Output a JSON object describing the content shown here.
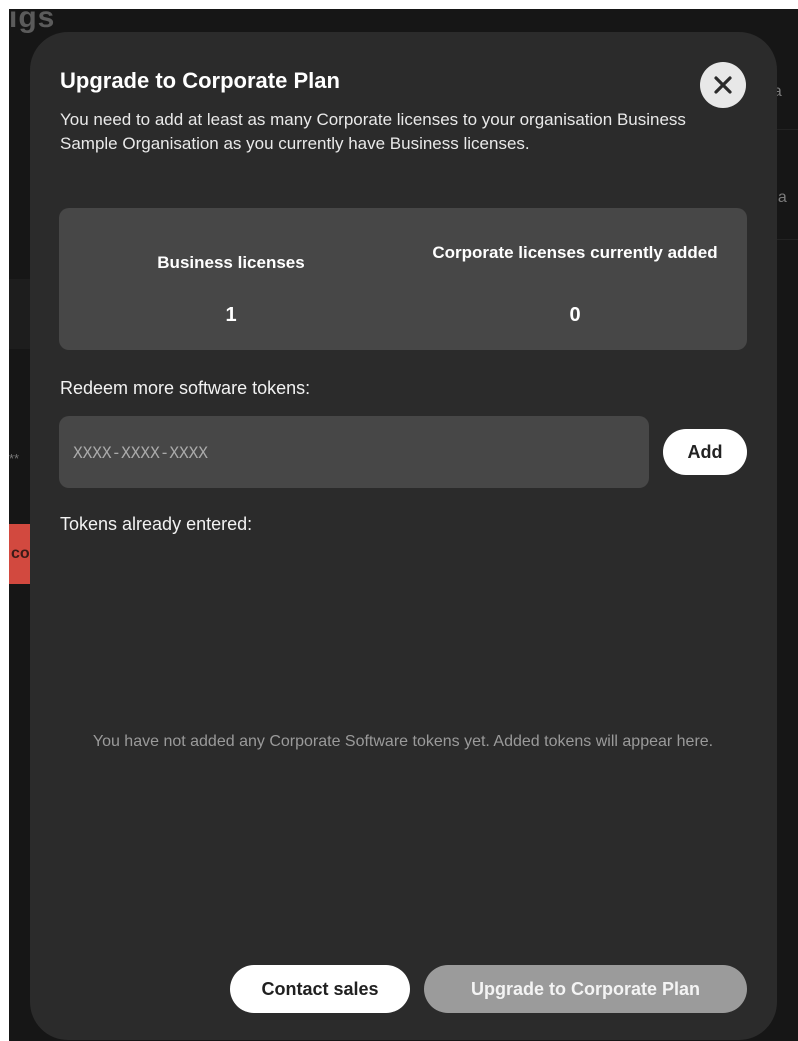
{
  "background": {
    "title_fragment": "igs",
    "right_fragment_1": "ua",
    "right_fragment_2": "na",
    "left_fragment": "**",
    "left_button_fragment": "co"
  },
  "modal": {
    "title": "Upgrade to Corporate Plan",
    "description": "You need to add at least as many Corporate licenses to your organisation Business Sample Organisation as you currently have Business licenses.",
    "close_icon": "close-icon",
    "summary": {
      "business_label": "Business licenses",
      "business_value": "1",
      "corporate_label": "Corporate licenses currently added",
      "corporate_value": "0"
    },
    "redeem_label": "Redeem more software tokens:",
    "token_placeholder": "XXXX-XXXX-XXXX",
    "add_label": "Add",
    "entered_label": "Tokens already entered:",
    "empty_message": "You have not added any Corporate Software tokens yet. Added tokens will appear here.",
    "contact_label": "Contact sales",
    "upgrade_label": "Upgrade to Corporate Plan"
  },
  "colors": {
    "modal_bg": "#2b2b2b",
    "panel_bg": "#474747",
    "upgrade_disabled": "#9b9b9b",
    "accent_red": "#d2493f"
  }
}
